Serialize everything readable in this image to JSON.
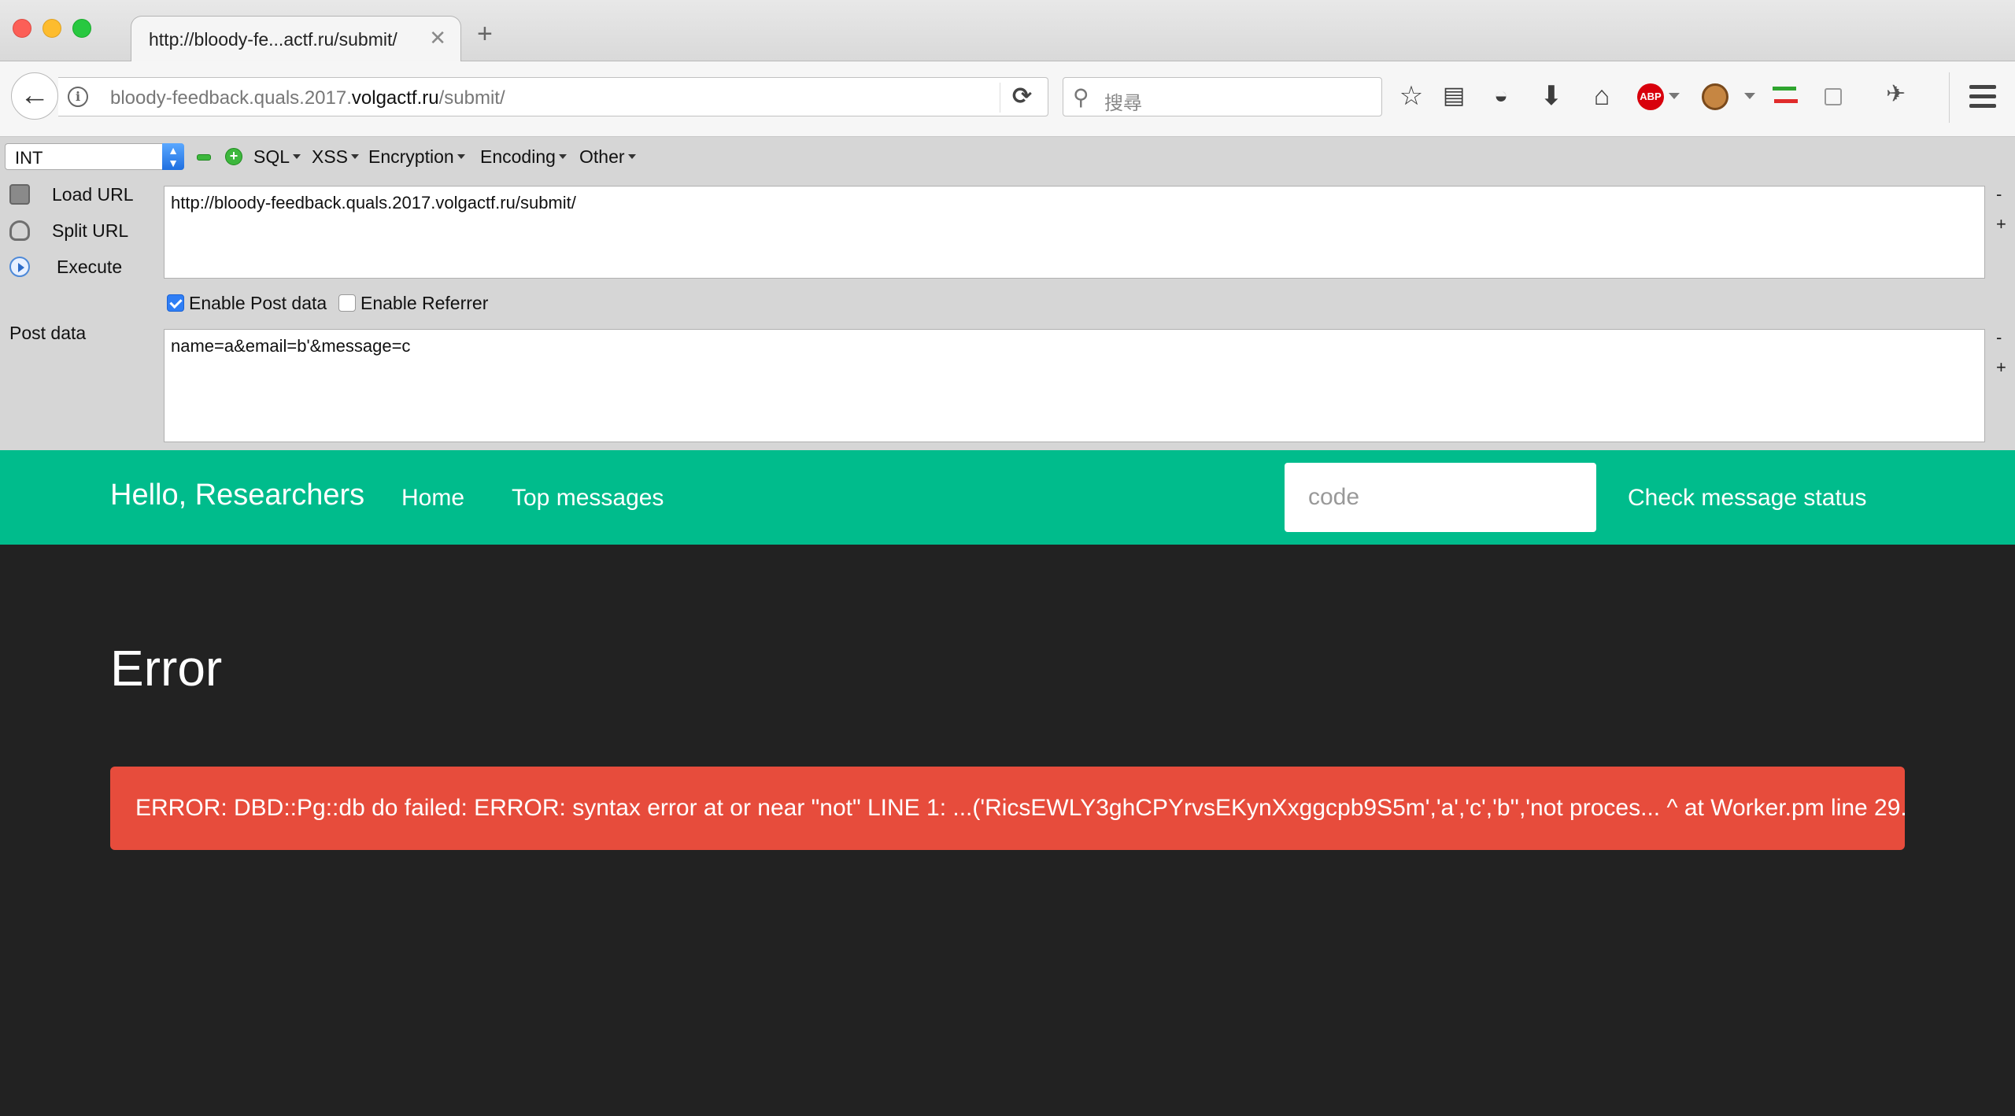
{
  "browser": {
    "tab_title": "http://bloody-fe...actf.ru/submit/",
    "tab_close": "✕",
    "new_tab": "+",
    "url_prefix": "bloody-feedback.quals.2017.",
    "url_domain": "volgactf.ru",
    "url_suffix": "/submit/",
    "search_placeholder": "搜尋",
    "abp_label": "ABP"
  },
  "hackbar": {
    "type_select": "INT",
    "menus": [
      "SQL",
      "XSS",
      "Encryption",
      "Encoding",
      "Other"
    ],
    "actions": {
      "load_url": "Load URL",
      "split_url": "Split URL",
      "execute": "Execute"
    },
    "url_value": "http://bloody-feedback.quals.2017.volgactf.ru/submit/",
    "enable_post_label": "Enable Post data",
    "enable_post_checked": true,
    "enable_referrer_label": "Enable Referrer",
    "enable_referrer_checked": false,
    "post_label": "Post data",
    "post_value": "name=a&email=b'&message=c",
    "shrink": "-",
    "grow": "+"
  },
  "site": {
    "brand": "Hello, Researchers",
    "nav_home": "Home",
    "nav_top": "Top messages",
    "code_placeholder": "code",
    "check_button": "Check message status",
    "nav_color": "#00bc8c"
  },
  "main": {
    "title": "Error",
    "error_message": "ERROR: DBD::Pg::db do failed: ERROR: syntax error at or near \"not\" LINE 1: ...('RicsEWLY3ghCPYrvsEKynXxggcpb9S5m','a','c','b'','not proces... ^ at Worker.pm line 29.",
    "error_color": "#e74c3c"
  }
}
